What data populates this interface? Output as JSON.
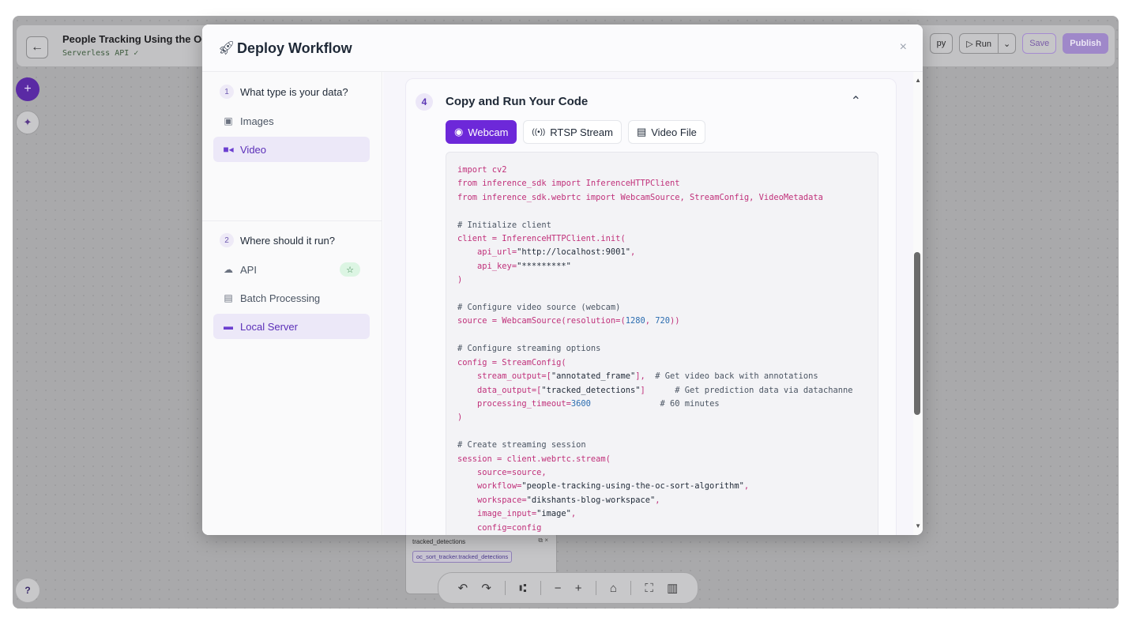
{
  "app": {
    "title": "People Tracking Using the OC",
    "subtitle": "Serverless API ✓",
    "toolbar": {
      "copy_label": "py",
      "run_label": "▷ Run",
      "save_label": "Save",
      "publish_label": "Publish"
    },
    "node": {
      "label": "tracked_detections",
      "tag": "oc_sort_tracker.tracked_detections"
    },
    "help_label": "?"
  },
  "modal": {
    "title": "Deploy Workflow",
    "close_label": "×",
    "step1": {
      "num": "1",
      "label": "What type is your data?"
    },
    "data_types": [
      {
        "label": "Images"
      },
      {
        "label": "Video"
      }
    ],
    "step2": {
      "num": "2",
      "label": "Where should it run?"
    },
    "targets": [
      {
        "label": "API"
      },
      {
        "label": "Batch Processing"
      },
      {
        "label": "Local Server"
      }
    ],
    "step4": {
      "num": "4",
      "title": "Copy and Run Your Code",
      "tabs": [
        {
          "label": "Webcam"
        },
        {
          "label": "RTSP Stream"
        },
        {
          "label": "Video File"
        }
      ]
    }
  },
  "code_lines": [
    "import cv2",
    "from inference_sdk import InferenceHTTPClient",
    "from inference_sdk.webrtc import WebcamSource, StreamConfig, VideoMetadata",
    "",
    "# Initialize client",
    "client = InferenceHTTPClient.init(",
    "    api_url=\"http://localhost:9001\",",
    "    api_key=\"*********\"",
    ")",
    "",
    "# Configure video source (webcam)",
    "source = WebcamSource(resolution=(1280, 720))",
    "",
    "# Configure streaming options",
    "config = StreamConfig(",
    "    stream_output=[\"annotated_frame\"],  # Get video back with annotations",
    "    data_output=[\"tracked_detections\"]      # Get prediction data via datachanne",
    "    processing_timeout=3600              # 60 minutes",
    ")",
    "",
    "# Create streaming session",
    "session = client.webrtc.stream(",
    "    source=source,",
    "    workflow=\"people-tracking-using-the-oc-sort-algorithm\",",
    "    workspace=\"dikshants-blog-workspace\",",
    "    image_input=\"image\",",
    "    config=config"
  ]
}
